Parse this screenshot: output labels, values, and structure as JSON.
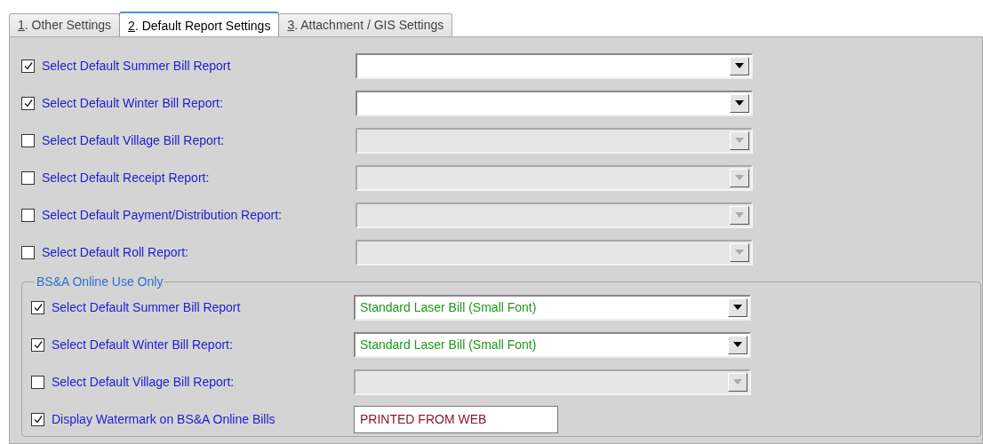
{
  "tabs": [
    {
      "label": "1. Other Settings",
      "selected": false
    },
    {
      "label": "2. Default Report Settings",
      "selected": true
    },
    {
      "label": "3. Attachment / GIS Settings",
      "selected": false
    }
  ],
  "rows": [
    {
      "label": "Select Default Summer Bill Report",
      "checked": true,
      "field": {
        "kind": "combo",
        "disabled": false
      }
    },
    {
      "label": "Select Default Winter Bill Report:",
      "checked": true,
      "field": {
        "kind": "combo",
        "disabled": false
      }
    },
    {
      "label": "Select Default Village Bill Report:",
      "checked": false,
      "field": {
        "kind": "combo",
        "disabled": true
      }
    },
    {
      "label": "Select Default Receipt Report:",
      "checked": false,
      "field": {
        "kind": "combo",
        "disabled": true
      }
    },
    {
      "label": "Select Default Payment/Distribution Report:",
      "checked": false,
      "field": {
        "kind": "combo",
        "disabled": true
      }
    },
    {
      "label": "Select Default Roll Report:",
      "checked": false,
      "field": {
        "kind": "combo",
        "disabled": true
      }
    }
  ],
  "online_group": {
    "title": "BS&A Online Use Only",
    "rows": [
      {
        "label": "Select Default Summer Bill Report",
        "checked": true,
        "field": {
          "kind": "combo",
          "disabled": false,
          "value": "Standard Laser Bill (Small Font)"
        }
      },
      {
        "label": "Select Default Winter Bill Report:",
        "checked": true,
        "field": {
          "kind": "combo",
          "disabled": false,
          "value": "Standard Laser Bill (Small Font)"
        }
      },
      {
        "label": "Select Default Village Bill Report:",
        "checked": false,
        "field": {
          "kind": "combo",
          "disabled": true
        }
      },
      {
        "label": "Display Watermark on BS&A Online Bills",
        "checked": true,
        "field": {
          "kind": "text",
          "disabled": false,
          "value": "PRINTED FROM WEB"
        }
      }
    ]
  }
}
